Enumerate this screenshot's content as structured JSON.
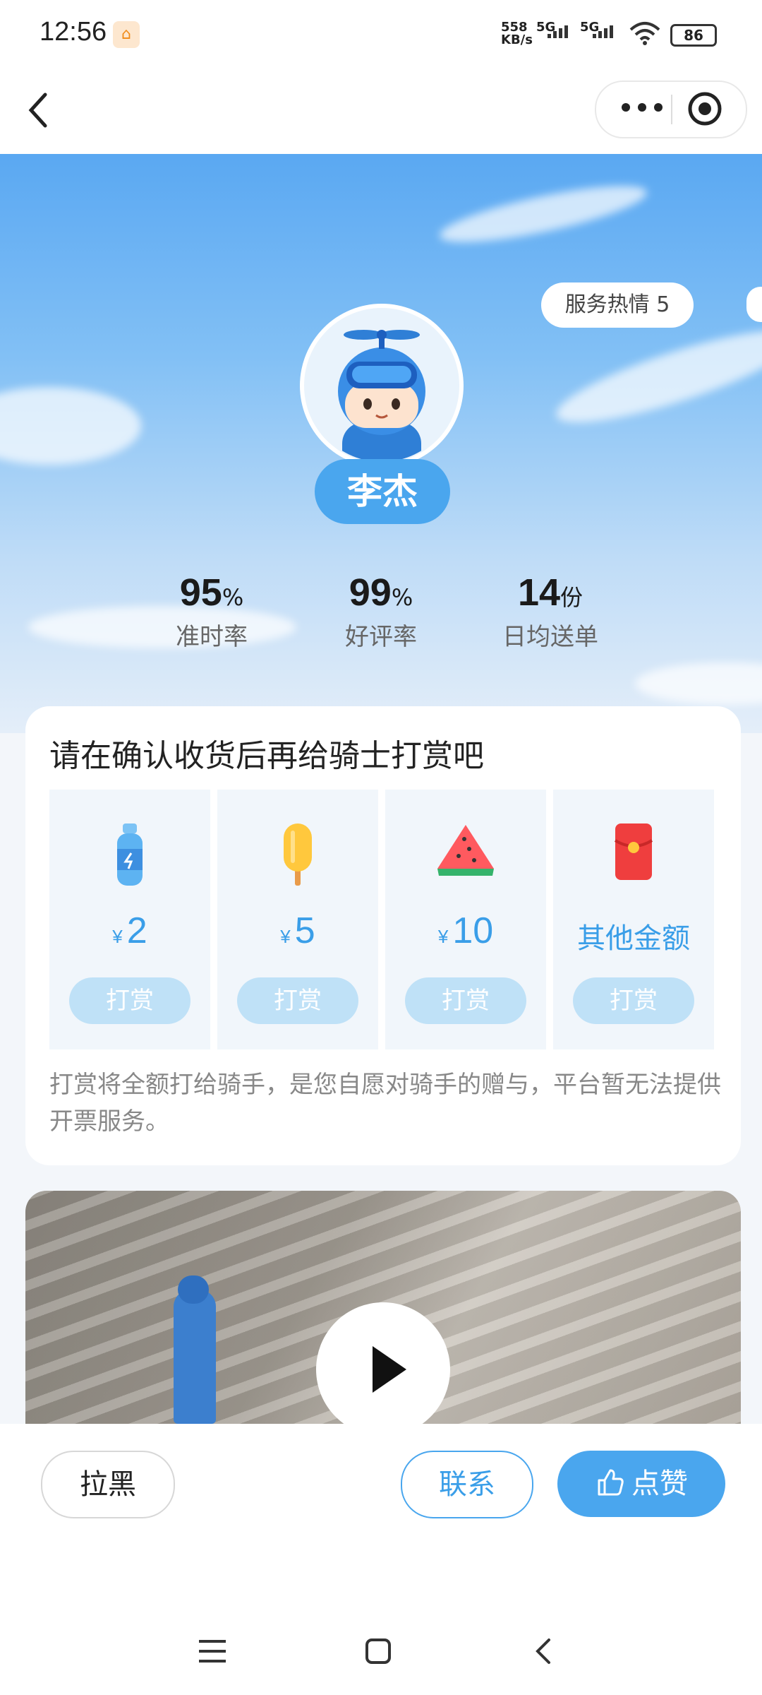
{
  "status_bar": {
    "time": "12:56",
    "net_speed_value": "558",
    "net_speed_unit": "KB/s",
    "signal1": "5G",
    "signal2": "5G",
    "battery": "86"
  },
  "hero": {
    "service_tag": "服务热情 5",
    "rider_name": "李杰",
    "stats": [
      {
        "value": "95",
        "unit": "%",
        "label": "准时率"
      },
      {
        "value": "99",
        "unit": "%",
        "label": "好评率"
      },
      {
        "value": "14",
        "unit": "份",
        "label": "日均送单"
      }
    ]
  },
  "tip_card": {
    "title": "请在确认收货后再给骑士打赏吧",
    "currency": "¥",
    "options": [
      {
        "icon": "water-bottle-icon",
        "amount": "2",
        "button": "打赏"
      },
      {
        "icon": "popsicle-icon",
        "amount": "5",
        "button": "打赏"
      },
      {
        "icon": "watermelon-icon",
        "amount": "10",
        "button": "打赏"
      },
      {
        "icon": "red-envelope-icon",
        "amount": "其他金额",
        "button": "打赏"
      }
    ],
    "note": "打赏将全额打给骑手，是您自愿对骑手的赠与，平台暂无法提供开票服务。"
  },
  "actions": {
    "block": "拉黑",
    "contact": "联系",
    "like": "点赞"
  },
  "colors": {
    "accent": "#4aa6ee",
    "tip_bg": "#f1f6fb",
    "tip_button": "#bfe1f7"
  }
}
